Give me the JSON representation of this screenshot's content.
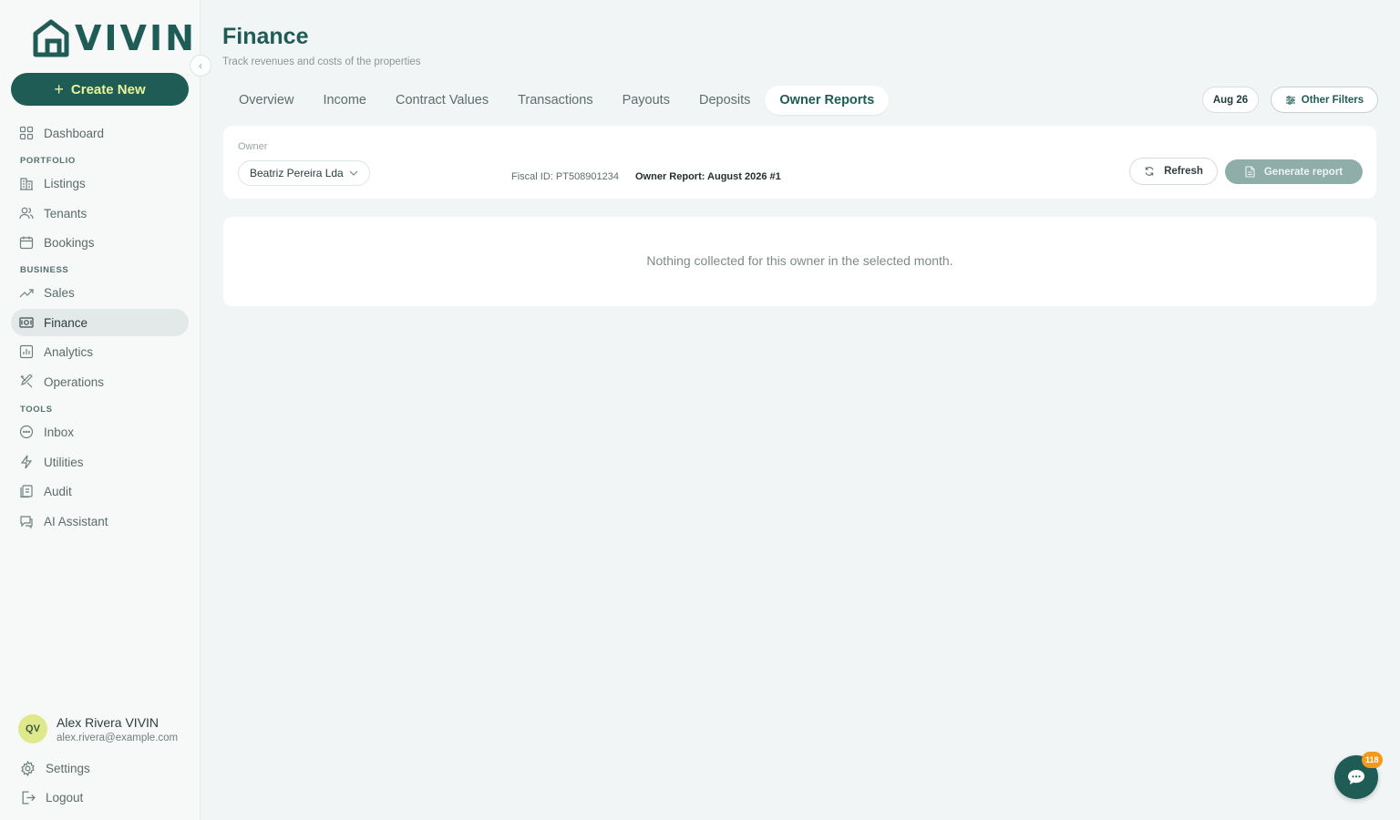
{
  "brand": {
    "name": "VIVIN",
    "accent": "#1f5c56",
    "highlight": "#e9f59a"
  },
  "sidebar": {
    "create_label": "Create New",
    "items": {
      "dashboard": "Dashboard",
      "portfolio_section": "PORTFOLIO",
      "listings": "Listings",
      "tenants": "Tenants",
      "bookings": "Bookings",
      "business_section": "BUSINESS",
      "sales": "Sales",
      "finance": "Finance",
      "analytics": "Analytics",
      "operations": "Operations",
      "tools_section": "TOOLS",
      "inbox": "Inbox",
      "utilities": "Utilities",
      "audit": "Audit",
      "ai_assistant": "AI Assistant"
    },
    "active": "finance",
    "user": {
      "initials": "QV",
      "name": "Alex Rivera VIVIN",
      "email": "alex.rivera@example.com"
    },
    "settings": "Settings",
    "logout": "Logout"
  },
  "header": {
    "title": "Finance",
    "subtitle": "Track revenues and costs of the properties"
  },
  "tabs": [
    "Overview",
    "Income",
    "Contract Values",
    "Transactions",
    "Payouts",
    "Deposits",
    "Owner Reports"
  ],
  "active_tab": "Owner Reports",
  "filters": {
    "period": "Aug 26",
    "other_filters": "Other Filters"
  },
  "owner_report": {
    "owner_label": "Owner",
    "owner_value": "Beatriz Pereira Lda",
    "fiscal_id": "Fiscal ID: PT508901234",
    "report_title": "Owner Report: August 2026 #1",
    "refresh_label": "Refresh",
    "generate_label": "Generate report",
    "empty_message": "Nothing collected for this owner in the selected month."
  },
  "chat": {
    "badge": "118"
  }
}
